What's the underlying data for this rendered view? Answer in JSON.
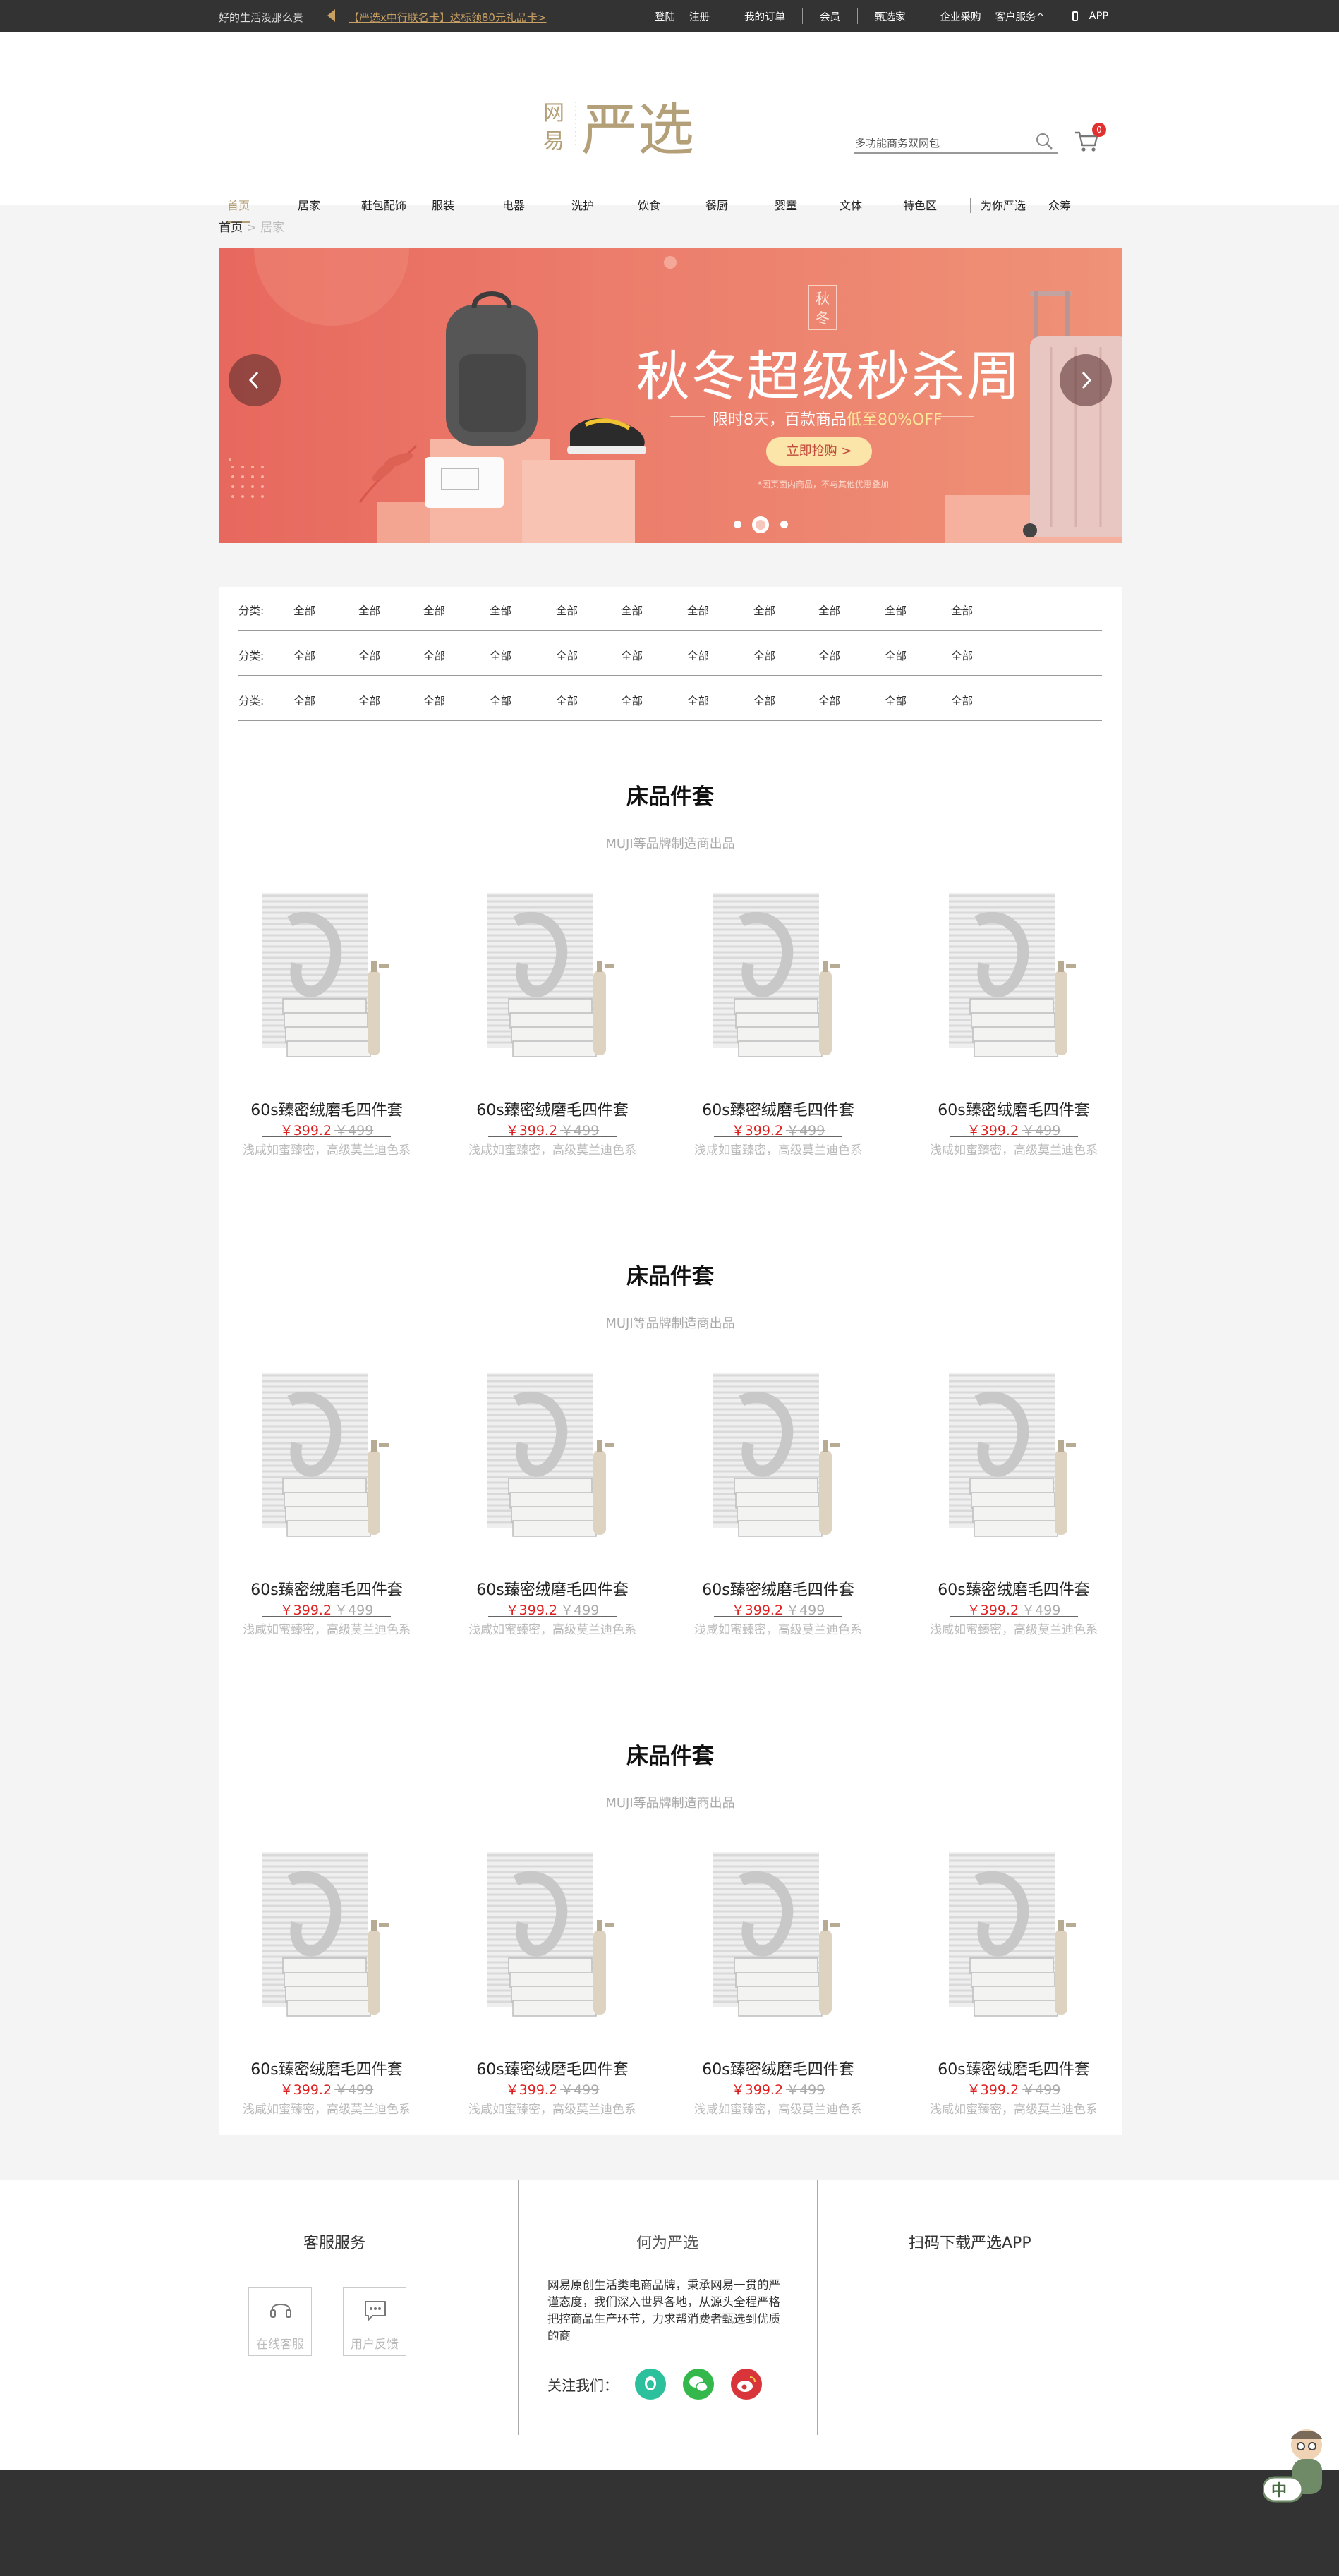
{
  "topbar": {
    "slogan": "好的生活没那么贵",
    "promo": "【严选x中行联名卡】达标领80元礼品卡>",
    "links": [
      "登陆",
      "注册",
      "我的订单",
      "会员",
      "甄选家",
      "企业采购",
      "客户服务^",
      "APP"
    ]
  },
  "header": {
    "logo_small": "网易",
    "logo_big": "严选",
    "search_placeholder": "多功能商务双网包",
    "cart_count": "0",
    "nav": [
      "首页",
      "居家",
      "鞋包配饰",
      "服装",
      "电器",
      "洗护",
      "饮食",
      "餐厨",
      "婴童",
      "文体",
      "特色区",
      "为你严选",
      "众筹"
    ]
  },
  "breadcrumb": {
    "home": "首页",
    "sep": ">",
    "current": "居家"
  },
  "banner": {
    "stamp": "秋冬",
    "title": "秋冬超级秒杀周",
    "sub_prefix": "限时8天，百款商品",
    "sub_highlight": "低至80%OFF",
    "button": "立即抢购 >",
    "note": "*因页面内商品，不与其他优惠叠加",
    "slides": 3,
    "active_slide": 2
  },
  "filters": {
    "label": "分类:",
    "rows": [
      [
        "全部",
        "全部",
        "全部",
        "全部",
        "全部",
        "全部",
        "全部",
        "全部",
        "全部",
        "全部",
        "全部"
      ],
      [
        "全部",
        "全部",
        "全部",
        "全部",
        "全部",
        "全部",
        "全部",
        "全部",
        "全部",
        "全部",
        "全部"
      ],
      [
        "全部",
        "全部",
        "全部",
        "全部",
        "全部",
        "全部",
        "全部",
        "全部",
        "全部",
        "全部",
        "全部"
      ]
    ]
  },
  "sections": [
    {
      "title": "床品件套",
      "subtitle": "MUJI等品牌制造商出品",
      "products": [
        {
          "name": "60s臻密绒磨毛四件套",
          "price": "￥399.2",
          "original_price": "￥499",
          "desc": "浅咸如蜜臻密，高级莫兰迪色系"
        },
        {
          "name": "60s臻密绒磨毛四件套",
          "price": "￥399.2",
          "original_price": "￥499",
          "desc": "浅咸如蜜臻密，高级莫兰迪色系"
        },
        {
          "name": "60s臻密绒磨毛四件套",
          "price": "￥399.2",
          "original_price": "￥499",
          "desc": "浅咸如蜜臻密，高级莫兰迪色系"
        },
        {
          "name": "60s臻密绒磨毛四件套",
          "price": "￥399.2",
          "original_price": "￥499",
          "desc": "浅咸如蜜臻密，高级莫兰迪色系"
        }
      ]
    },
    {
      "title": "床品件套",
      "subtitle": "MUJI等品牌制造商出品",
      "products": [
        {
          "name": "60s臻密绒磨毛四件套",
          "price": "￥399.2",
          "original_price": "￥499",
          "desc": "浅咸如蜜臻密，高级莫兰迪色系"
        },
        {
          "name": "60s臻密绒磨毛四件套",
          "price": "￥399.2",
          "original_price": "￥499",
          "desc": "浅咸如蜜臻密，高级莫兰迪色系"
        },
        {
          "name": "60s臻密绒磨毛四件套",
          "price": "￥399.2",
          "original_price": "￥499",
          "desc": "浅咸如蜜臻密，高级莫兰迪色系"
        },
        {
          "name": "60s臻密绒磨毛四件套",
          "price": "￥399.2",
          "original_price": "￥499",
          "desc": "浅咸如蜜臻密，高级莫兰迪色系"
        }
      ]
    },
    {
      "title": "床品件套",
      "subtitle": "MUJI等品牌制造商出品",
      "products": [
        {
          "name": "60s臻密绒磨毛四件套",
          "price": "￥399.2",
          "original_price": "￥499",
          "desc": "浅咸如蜜臻密，高级莫兰迪色系"
        },
        {
          "name": "60s臻密绒磨毛四件套",
          "price": "￥399.2",
          "original_price": "￥499",
          "desc": "浅咸如蜜臻密，高级莫兰迪色系"
        },
        {
          "name": "60s臻密绒磨毛四件套",
          "price": "￥399.2",
          "original_price": "￥499",
          "desc": "浅咸如蜜臻密，高级莫兰迪色系"
        },
        {
          "name": "60s臻密绒磨毛四件套",
          "price": "￥399.2",
          "original_price": "￥499",
          "desc": "浅咸如蜜臻密，高级莫兰迪色系"
        }
      ]
    }
  ],
  "footer": {
    "service_title": "客服服务",
    "online_service": "在线客服",
    "feedback": "用户反馈",
    "about_title": "何为严选",
    "about_text": "网易原创生活类电商品牌，秉承网易一贯的严谨态度，我们深入世界各地，从源头全程严格把控商品生产环节，力求帮消费者甄选到优质的商",
    "follow": "关注我们：",
    "app_title": "扫码下载严选APP"
  },
  "mascot": {
    "badge": "中"
  },
  "colors": {
    "accent": "#b4a078",
    "price": "#e02020",
    "topbar": "#333333",
    "banner": "#ec7d6c"
  },
  "icons": [
    "search-icon",
    "cart-icon",
    "phone-icon",
    "headset-icon",
    "chat-icon",
    "chevron-left-icon",
    "chevron-right-icon",
    "weibo-icon",
    "wechat-icon",
    "qq-icon"
  ]
}
